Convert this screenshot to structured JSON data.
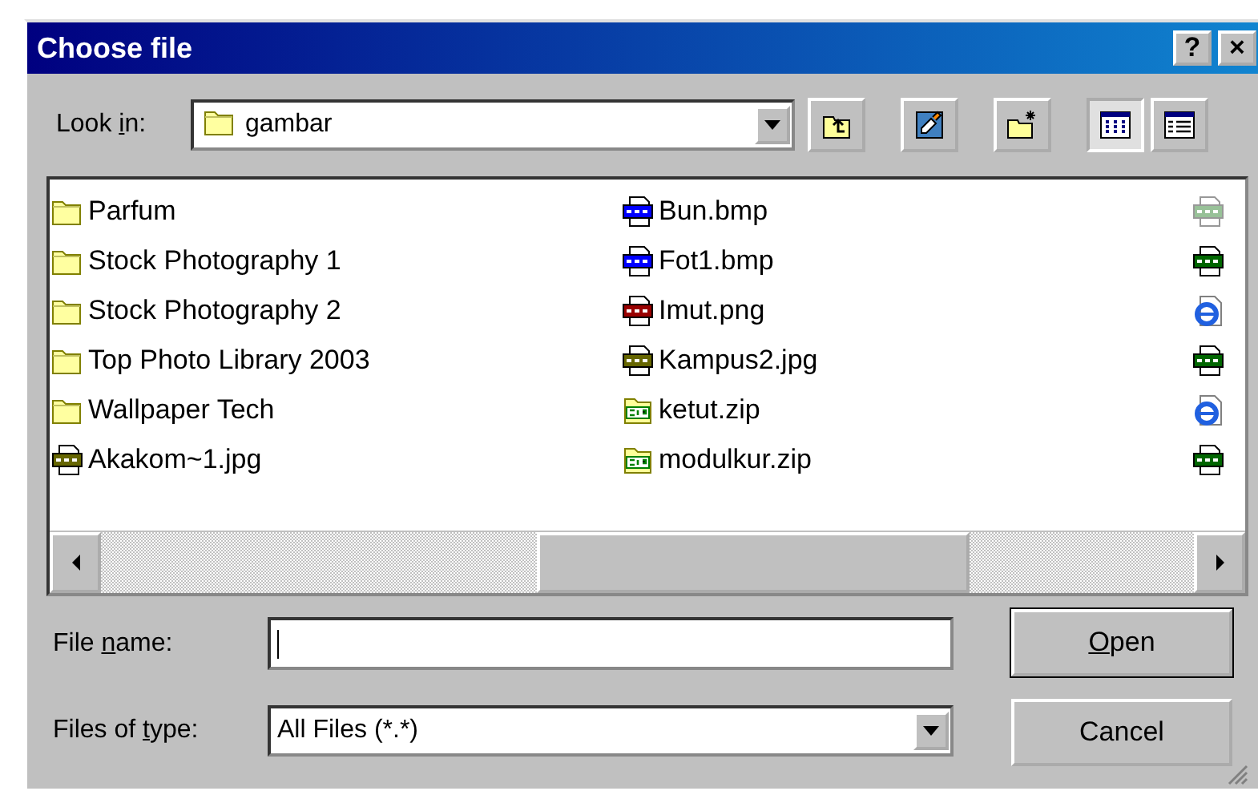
{
  "window": {
    "title": "Choose file",
    "buttons": [
      {
        "kind": "help",
        "label": "?"
      },
      {
        "kind": "close",
        "label": "×"
      }
    ]
  },
  "look_in": {
    "label": {
      "before": "Look ",
      "key": "i",
      "after": "n:"
    },
    "value": "gambar",
    "toolbar": [
      {
        "kind": "up",
        "pressed": false
      },
      {
        "kind": "desktop",
        "pressed": false
      },
      {
        "kind": "new-folder",
        "pressed": false
      },
      {
        "kind": "list-view",
        "pressed": true
      },
      {
        "kind": "details-view",
        "pressed": false
      }
    ]
  },
  "file_list": {
    "columns": [
      [
        {
          "kind": "folder",
          "name": "Parfum"
        },
        {
          "kind": "folder",
          "name": "Stock Photography 1"
        },
        {
          "kind": "folder",
          "name": "Stock Photography 2"
        },
        {
          "kind": "folder",
          "name": "Top Photo Library 2003"
        },
        {
          "kind": "folder",
          "name": "Wallpaper Tech"
        },
        {
          "kind": "jpg",
          "name": "Akakom~1.jpg"
        }
      ],
      [
        {
          "kind": "bmp",
          "name": "Bun.bmp"
        },
        {
          "kind": "bmp",
          "name": "Fot1.bmp"
        },
        {
          "kind": "png",
          "name": "Imut.png"
        },
        {
          "kind": "jpg",
          "name": "Kampus2.jpg"
        },
        {
          "kind": "zip",
          "name": "ketut.zip"
        },
        {
          "kind": "zip",
          "name": "modulkur.zip"
        }
      ],
      [
        {
          "kind": "gif",
          "dimmed": true
        },
        {
          "kind": "gif",
          "dimmed": false
        },
        {
          "kind": "html",
          "dimmed": false
        },
        {
          "kind": "gif",
          "dimmed": false
        },
        {
          "kind": "html",
          "dimmed": false
        },
        {
          "kind": "gif",
          "dimmed": false
        }
      ]
    ]
  },
  "file_name": {
    "label": {
      "before": "File ",
      "key": "n",
      "after": "ame:"
    }
  },
  "file_type": {
    "label": {
      "before": "Files of ",
      "key": "t",
      "after": "ype:"
    },
    "value": "All Files (*.*)"
  },
  "buttons": [
    {
      "kind": "default",
      "label": {
        "key": "O",
        "after": "pen"
      }
    },
    {
      "kind": "normal",
      "label": {
        "before": "Cancel"
      }
    }
  ]
}
